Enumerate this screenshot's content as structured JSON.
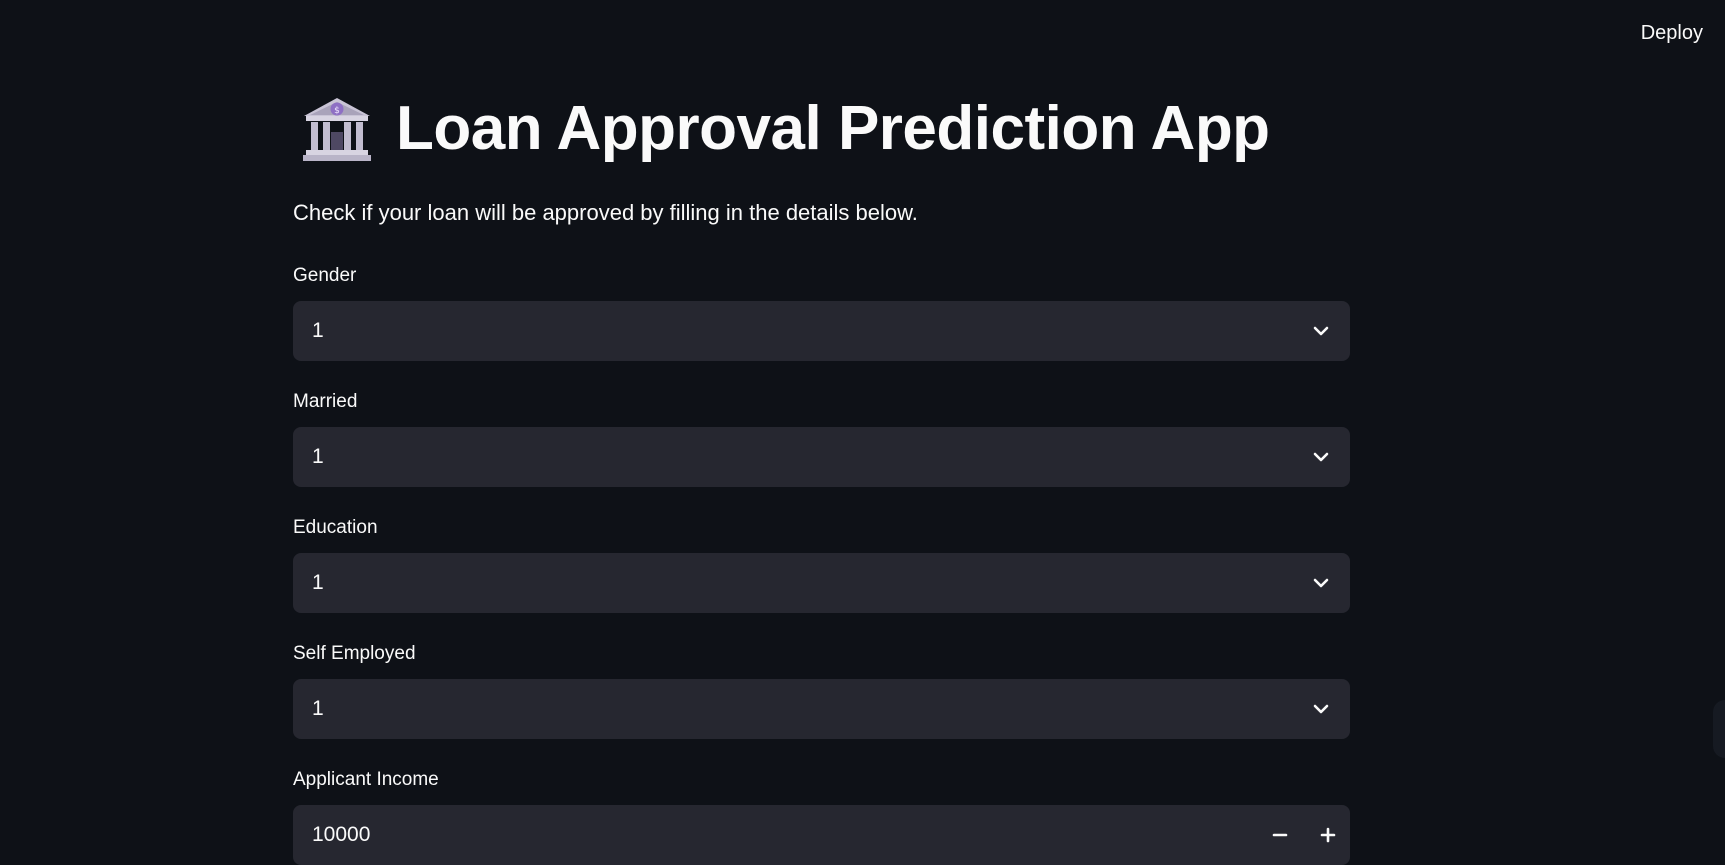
{
  "header": {
    "deploy_label": "Deploy"
  },
  "app": {
    "title": "Loan Approval Prediction App",
    "title_icon": "bank-icon",
    "subtitle": "Check if your loan will be approved by filling in the details below."
  },
  "fields": {
    "gender": {
      "label": "Gender",
      "value": "1"
    },
    "married": {
      "label": "Married",
      "value": "1"
    },
    "education": {
      "label": "Education",
      "value": "1"
    },
    "self_employed": {
      "label": "Self Employed",
      "value": "1"
    },
    "applicant_income": {
      "label": "Applicant Income",
      "value": "10000"
    }
  },
  "colors": {
    "background": "#0e1117",
    "input_background": "#262730",
    "text": "#fafafa"
  }
}
